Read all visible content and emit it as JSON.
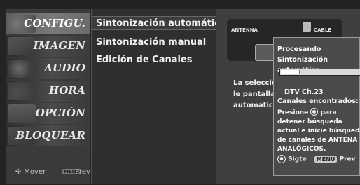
{
  "sidebar": {
    "items": [
      {
        "label": "CONFIGU.",
        "active": true
      },
      {
        "label": "IMAGEN",
        "active": false
      },
      {
        "label": "AUDIO",
        "active": false
      },
      {
        "label": "HORA",
        "active": false
      },
      {
        "label": "OPCIÓN",
        "active": false
      },
      {
        "label": "BLOQUEAR",
        "active": false
      }
    ],
    "nav": {
      "move": "Mover",
      "menu_key": "MENU",
      "prev": "Prev"
    }
  },
  "list": {
    "items": [
      {
        "label": "Sintonización automática",
        "selected": true
      },
      {
        "label": "Sintonización manual",
        "selected": false
      },
      {
        "label": "Edición  de Canales",
        "selected": false
      }
    ]
  },
  "connection": {
    "antenna_label": "ANTENNA",
    "cable_label": "CABLE"
  },
  "description": "La selección le pantalla S automática",
  "popup": {
    "title": "Procesando Sintonización automática ...",
    "progress": 0.22,
    "channel": "DTV Ch.23",
    "found": "Canales encontrados: 10",
    "msg_before": "Presione",
    "msg_after": "para detener búsqueda actual e inicie búsqueda de canales de ANTENA ANALÓGICOS.",
    "next_label": "Sigte",
    "menu_key": "MENU",
    "prev_label": "Prev"
  }
}
